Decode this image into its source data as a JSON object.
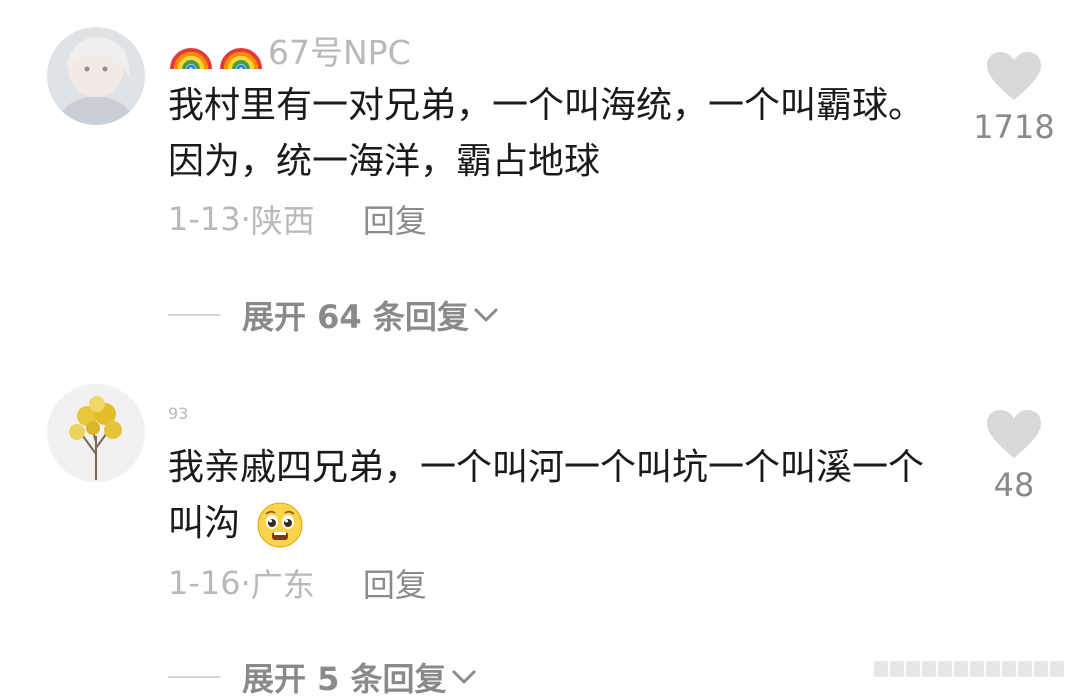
{
  "comments": [
    {
      "username": "67号NPC",
      "content": "我村里有一对兄弟，一个叫海统，一个叫霸球。因为，统一海洋，霸占地球",
      "date": "1-13",
      "location": "陕西",
      "reply_label": "回复",
      "likes": "1718",
      "expand_label": "展开 64 条回复"
    },
    {
      "username": "93",
      "content": "我亲戚四兄弟，一个叫河一个叫坑一个叫溪一个叫沟",
      "date": "1-16",
      "location": "广东",
      "reply_label": "回复",
      "likes": "48",
      "expand_label": "展开 5 条回复"
    }
  ],
  "icons": {
    "like": "heart-icon",
    "expand": "chevron-down-icon",
    "username_badge": "rainbow-icon",
    "emoji": "pleading-face-emoji"
  },
  "colors": {
    "text": "#1a1a1a",
    "muted": "#b9b9b9",
    "secondary": "#8a8a8a",
    "heart": "#d9d9d9"
  }
}
